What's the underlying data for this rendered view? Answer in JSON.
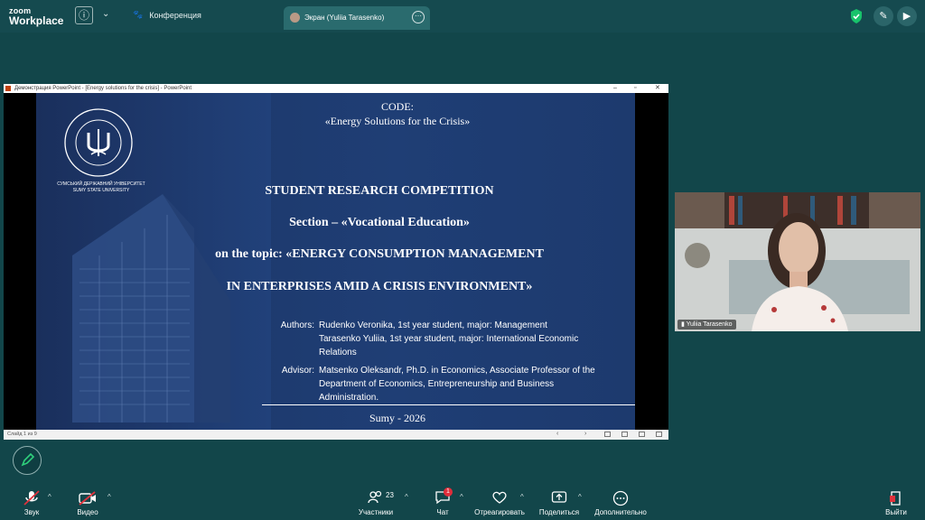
{
  "topbar": {
    "logo_line1": "zoom",
    "logo_line2": "Workplace",
    "meeting_label": "Конференция",
    "share_tab_label": "Экран (Yuliia Tarasenko)"
  },
  "ppt_window": {
    "title": "Демонстрация PowerPoint - [Energy solutions for the crisis] - PowerPoint",
    "status": "Слайд 1 из 9"
  },
  "slide": {
    "university": "СУМСЬКИЙ ДЕРЖАВНИЙ УНІВЕРСИТЕТ",
    "university_en": "SUMY STATE UNIVERSITY",
    "code_label": "CODE:",
    "code_value": "«Energy Solutions for the Crisis»",
    "competition": "STUDENT RESEARCH COMPETITION",
    "section": "Section – «Vocational Education»",
    "topic_line1": "on the topic:  «ENERGY CONSUMPTION MANAGEMENT",
    "topic_line2": "IN ENTERPRISES AMID A CRISIS ENVIRONMENT»",
    "authors_label": "Authors:",
    "author1": "Rudenko Veronika, 1st year student, major: Management",
    "author2a": "Tarasenko Yuliia, 1st year student, major: International Economic",
    "author2b": "Relations",
    "advisor_label": "Advisor:",
    "advisor1": "Matsenko Oleksandr, Ph.D. in Economics, Associate Professor of the",
    "advisor2": "Department of Economics, Entrepreneurship and Business",
    "advisor3": "Administration.",
    "footer": "Sumy - 2026"
  },
  "video": {
    "participant_name": "Yuliia Tarasenko"
  },
  "toolbar": {
    "audio": "Звук",
    "video": "Видео",
    "participants": "Участники",
    "participants_count": "23",
    "chat": "Чат",
    "chat_badge": "1",
    "react": "Отреагировать",
    "share": "Поделиться",
    "more": "Дополнительно",
    "leave": "Выйти"
  },
  "colors": {
    "accent_green": "#18c36b",
    "leave_red": "#e0323c",
    "slide_blue": "#1e3a6e",
    "badge_red": "#e02d3a"
  }
}
